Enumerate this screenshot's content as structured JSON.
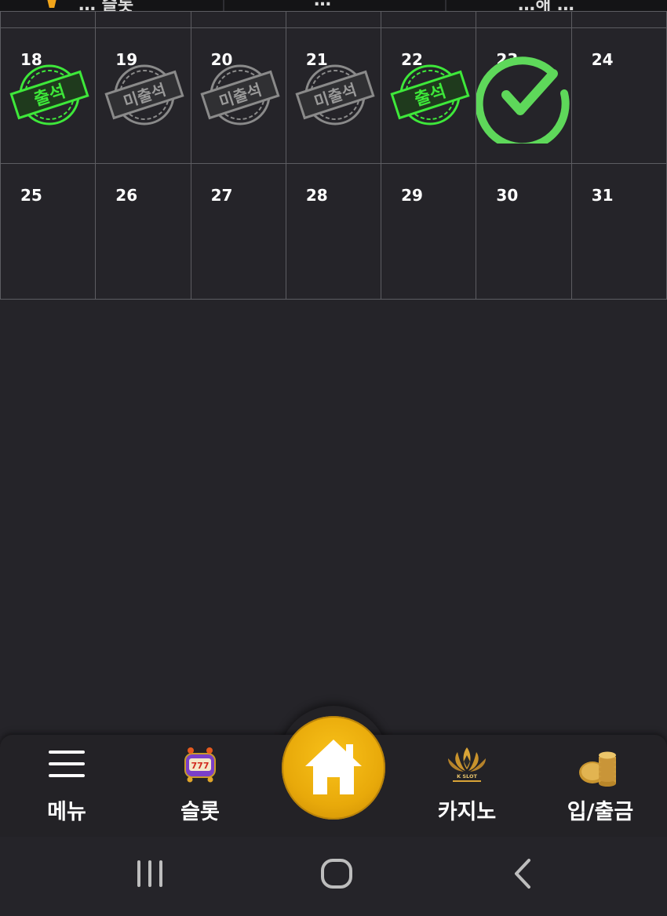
{
  "top_tabs": [
    {
      "label": "… 슬롯"
    },
    {
      "label": "…"
    },
    {
      "label": "…해 …"
    }
  ],
  "calendar": {
    "weeks": [
      [
        {
          "day": "18",
          "status": "attended",
          "stamp_text": "출석"
        },
        {
          "day": "19",
          "status": "absent",
          "stamp_text": "미출석"
        },
        {
          "day": "20",
          "status": "absent",
          "stamp_text": "미출석"
        },
        {
          "day": "21",
          "status": "absent",
          "stamp_text": "미출석"
        },
        {
          "day": "22",
          "status": "attended",
          "stamp_text": "출석"
        },
        {
          "day": "23",
          "status": "today-checked",
          "stamp_text": ""
        },
        {
          "day": "24",
          "status": "none",
          "stamp_text": ""
        }
      ],
      [
        {
          "day": "25",
          "status": "none",
          "stamp_text": ""
        },
        {
          "day": "26",
          "status": "none",
          "stamp_text": ""
        },
        {
          "day": "27",
          "status": "none",
          "stamp_text": ""
        },
        {
          "day": "28",
          "status": "none",
          "stamp_text": ""
        },
        {
          "day": "29",
          "status": "none",
          "stamp_text": ""
        },
        {
          "day": "30",
          "status": "none",
          "stamp_text": ""
        },
        {
          "day": "31",
          "status": "none",
          "stamp_text": ""
        }
      ]
    ],
    "colors": {
      "attended": "#3ee83a",
      "absent": "#8a8a8a",
      "check": "#5ed85a"
    }
  },
  "bottom_nav": {
    "menu": {
      "label": "메뉴",
      "icon": "hamburger-icon"
    },
    "slot": {
      "label": "슬롯",
      "icon": "slot-machine-icon"
    },
    "home": {
      "icon": "home-icon",
      "color": "#f2b411"
    },
    "casino": {
      "label": "카지노",
      "icon": "casino-logo-icon",
      "logo_text": "K SLOT"
    },
    "deposit": {
      "label": "입/출금",
      "icon": "coins-icon"
    }
  },
  "system_nav": {
    "recents": "recent-apps-icon",
    "home": "system-home-icon",
    "back": "back-icon"
  }
}
